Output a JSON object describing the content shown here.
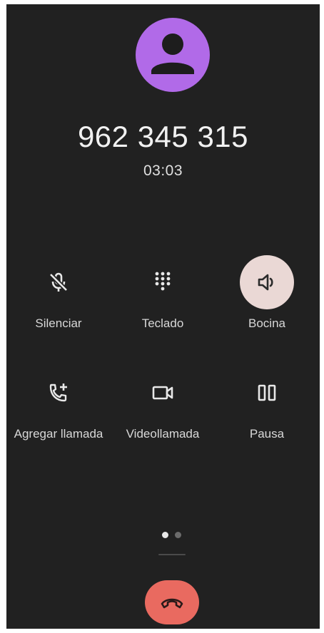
{
  "call": {
    "number": "962 345 315",
    "duration": "03:03"
  },
  "controls": {
    "mute": {
      "label": "Silenciar",
      "icon": "mic-off-icon",
      "active": false
    },
    "keypad": {
      "label": "Teclado",
      "icon": "dialpad-icon",
      "active": false
    },
    "speaker": {
      "label": "Bocina",
      "icon": "volume-icon",
      "active": true
    },
    "add_call": {
      "label": "Agregar llamada",
      "icon": "add-call-icon",
      "active": false
    },
    "video_call": {
      "label": "Videollamada",
      "icon": "videocam-icon",
      "active": false
    },
    "hold": {
      "label": "Pausa",
      "icon": "pause-icon",
      "active": false
    }
  },
  "pager": {
    "pages": 2,
    "current": 1
  },
  "colors": {
    "background": "#212121",
    "avatar": "#b16ae8",
    "end_call": "#e96a60",
    "active_control": "#ead8d5",
    "text": "#f1f1f1"
  }
}
